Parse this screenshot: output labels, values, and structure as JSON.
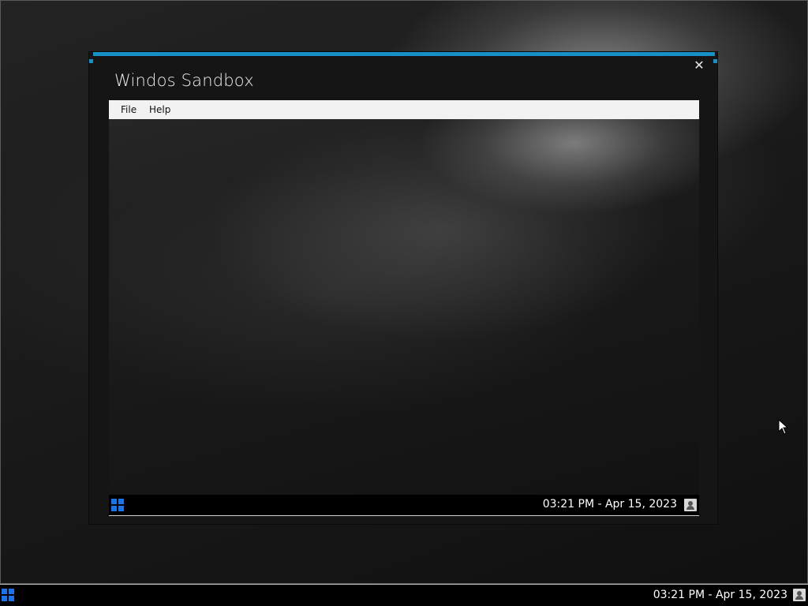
{
  "desktop": {
    "taskbar": {
      "clock": "03:21 PM - Apr 15, 2023",
      "start_icon": "windows-start-icon",
      "user_icon": "user-icon"
    }
  },
  "sandbox_window": {
    "title": "Windos Sandbox",
    "close_glyph": "✕",
    "accent_color": "#1690c6",
    "menu": {
      "file": "File",
      "help": "Help"
    },
    "taskbar": {
      "clock": "03:21 PM - Apr 15, 2023",
      "start_icon": "windows-start-icon",
      "user_icon": "user-icon"
    }
  },
  "colors": {
    "start_blue": "#1a73e8",
    "taskbar_bg": "#000000",
    "menubar_bg": "#f2f2f2"
  }
}
